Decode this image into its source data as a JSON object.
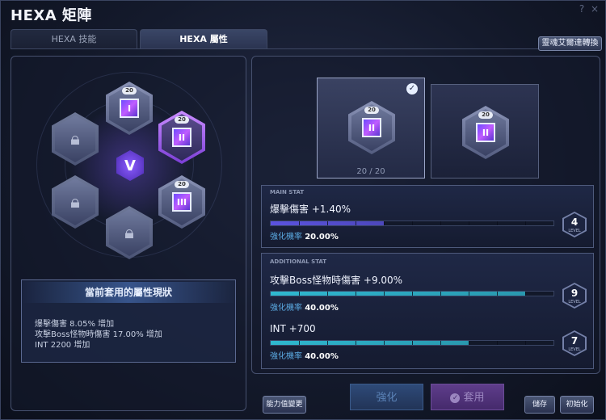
{
  "window": {
    "title": "HEXA 矩陣",
    "help_label": "?",
    "close_label": "×"
  },
  "tabs": [
    {
      "label": "HEXA 技能",
      "active": false
    },
    {
      "label": "HEXA 屬性",
      "active": true
    }
  ],
  "convert_button": "靈魂艾爾達轉換",
  "board": {
    "core_symbol": "V",
    "nodes": [
      {
        "id": "top",
        "level": "20",
        "glyph": "I",
        "state": "unlocked"
      },
      {
        "id": "upper-right",
        "level": "20",
        "glyph": "II",
        "state": "selected"
      },
      {
        "id": "lower-right",
        "level": "20",
        "glyph": "III",
        "state": "unlocked"
      },
      {
        "id": "upper-left",
        "state": "locked"
      },
      {
        "id": "lower-left",
        "state": "locked"
      },
      {
        "id": "bottom",
        "state": "locked"
      }
    ]
  },
  "status_panel": {
    "header": "當前套用的屬性現狀",
    "lines": [
      "爆擊傷害 8.05% 增加",
      "攻擊Boss怪物時傷害 17.00% 增加",
      "INT 2200 增加"
    ]
  },
  "cards": [
    {
      "level": "20",
      "glyph": "II",
      "selected": true,
      "count": "20 / 20"
    },
    {
      "level": "20",
      "glyph": "II",
      "selected": false
    }
  ],
  "main_stat": {
    "header": "MAIN STAT",
    "name": "爆擊傷害 +1.40%",
    "prob_label": "強化機率",
    "prob_value": "20.00%",
    "level": "4",
    "level_word": "LEVEL",
    "fill_fraction": 0.4,
    "fill_color": "#5b53e0"
  },
  "additional_stat": {
    "header": "ADDITIONAL STAT",
    "items": [
      {
        "name": "攻擊Boss怪物時傷害 +9.00%",
        "prob_label": "強化機率",
        "prob_value": "40.00%",
        "level": "9",
        "level_word": "LEVEL",
        "fill_fraction": 0.9,
        "fill_color": "#2fb8d0"
      },
      {
        "name": "INT +700",
        "prob_label": "強化機率",
        "prob_value": "40.00%",
        "level": "7",
        "level_word": "LEVEL",
        "fill_fraction": 0.7,
        "fill_color": "#2fb8d0"
      }
    ]
  },
  "buttons": {
    "ability_change": "能力值變更",
    "enhance": "強化",
    "apply": "套用",
    "save": "儲存",
    "reset": "初始化"
  }
}
